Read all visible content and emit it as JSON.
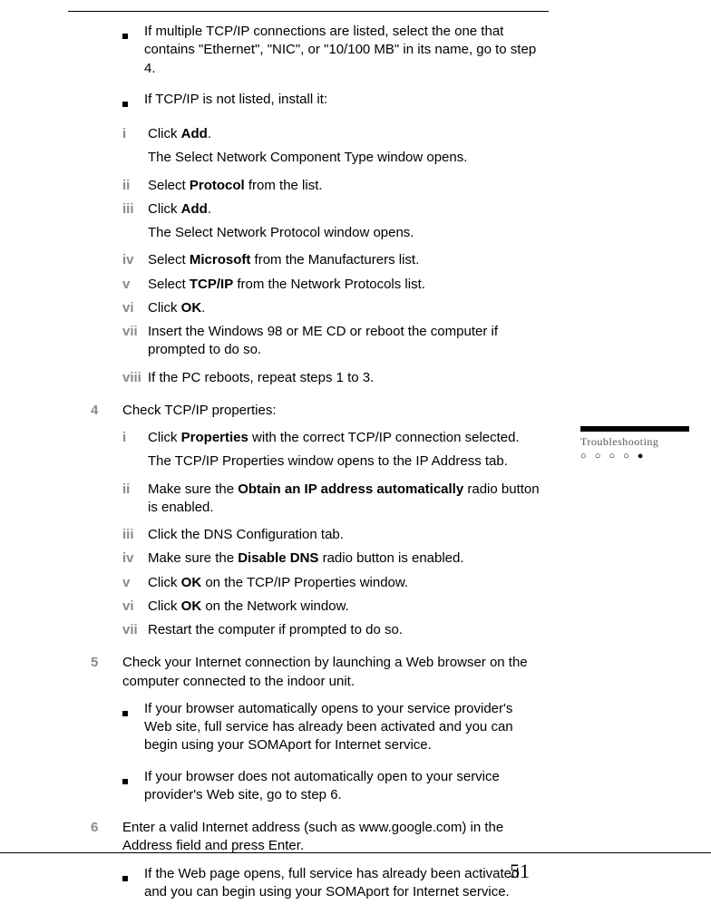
{
  "side": {
    "label": "Troubleshooting",
    "dots": "○ ○ ○ ○ ●"
  },
  "pageNumber": "51",
  "bullets_top": [
    "If multiple TCP/IP connections are listed, select the one that contains \"Ethernet\", \"NIC\", or \"10/100 MB\" in its name, go to step 4.",
    "If TCP/IP is not listed, install it:"
  ],
  "install_steps": {
    "i": {
      "pre": "Click ",
      "bold": "Add",
      "post": "."
    },
    "i_result": "The Select Network Component Type window opens.",
    "ii": {
      "pre": "Select ",
      "bold": "Protocol",
      "post": " from the list."
    },
    "iii": {
      "pre": "Click ",
      "bold": "Add",
      "post": "."
    },
    "iii_result": "The Select Network Protocol window opens.",
    "iv": {
      "pre": "Select ",
      "bold": "Microsoft",
      "post": " from the Manufacturers list."
    },
    "v": {
      "pre": "Select ",
      "bold": "TCP/IP",
      "post": " from the Network Protocols list."
    },
    "vi": {
      "pre": "Click ",
      "bold": "OK",
      "post": "."
    },
    "vii": "Insert the Windows 98 or ME CD or reboot the computer if prompted to do so.",
    "viii": "If the PC reboots, repeat steps 1 to 3."
  },
  "step4": {
    "label": "4",
    "text": "Check TCP/IP properties:",
    "subs": {
      "i": {
        "pre": "Click ",
        "bold": "Properties",
        "post": " with the correct TCP/IP connection selected."
      },
      "i_result": "The TCP/IP Properties window opens to the IP Address tab.",
      "ii": {
        "pre": "Make sure the ",
        "bold": "Obtain an IP address automatically",
        "post": " radio button is enabled."
      },
      "iii": "Click the DNS Configuration tab.",
      "iv": {
        "pre": "Make sure the ",
        "bold": "Disable DNS",
        "post": " radio button is enabled."
      },
      "v": {
        "pre": "Click ",
        "bold": "OK",
        "post": " on the TCP/IP Properties window."
      },
      "vi": {
        "pre": "Click ",
        "bold": "OK",
        "post": " on the Network window."
      },
      "vii": "Restart the computer if prompted to do so."
    }
  },
  "step5": {
    "label": "5",
    "text": "Check your Internet connection by launching a Web browser on the computer connected to the indoor unit.",
    "bullets": [
      "If your browser automatically opens to your service provider's Web site, full service has already been activated and you can begin using your SOMAport for Internet service.",
      "If your browser does not automatically open to your service provider's Web site, go to step 6."
    ]
  },
  "step6": {
    "label": "6",
    "text": "Enter a valid Internet address (such as www.google.com) in the Address field and press Enter.",
    "bullets": [
      "If the Web page opens, full service has already been activated and you can begin using your SOMAport for Internet service."
    ]
  }
}
